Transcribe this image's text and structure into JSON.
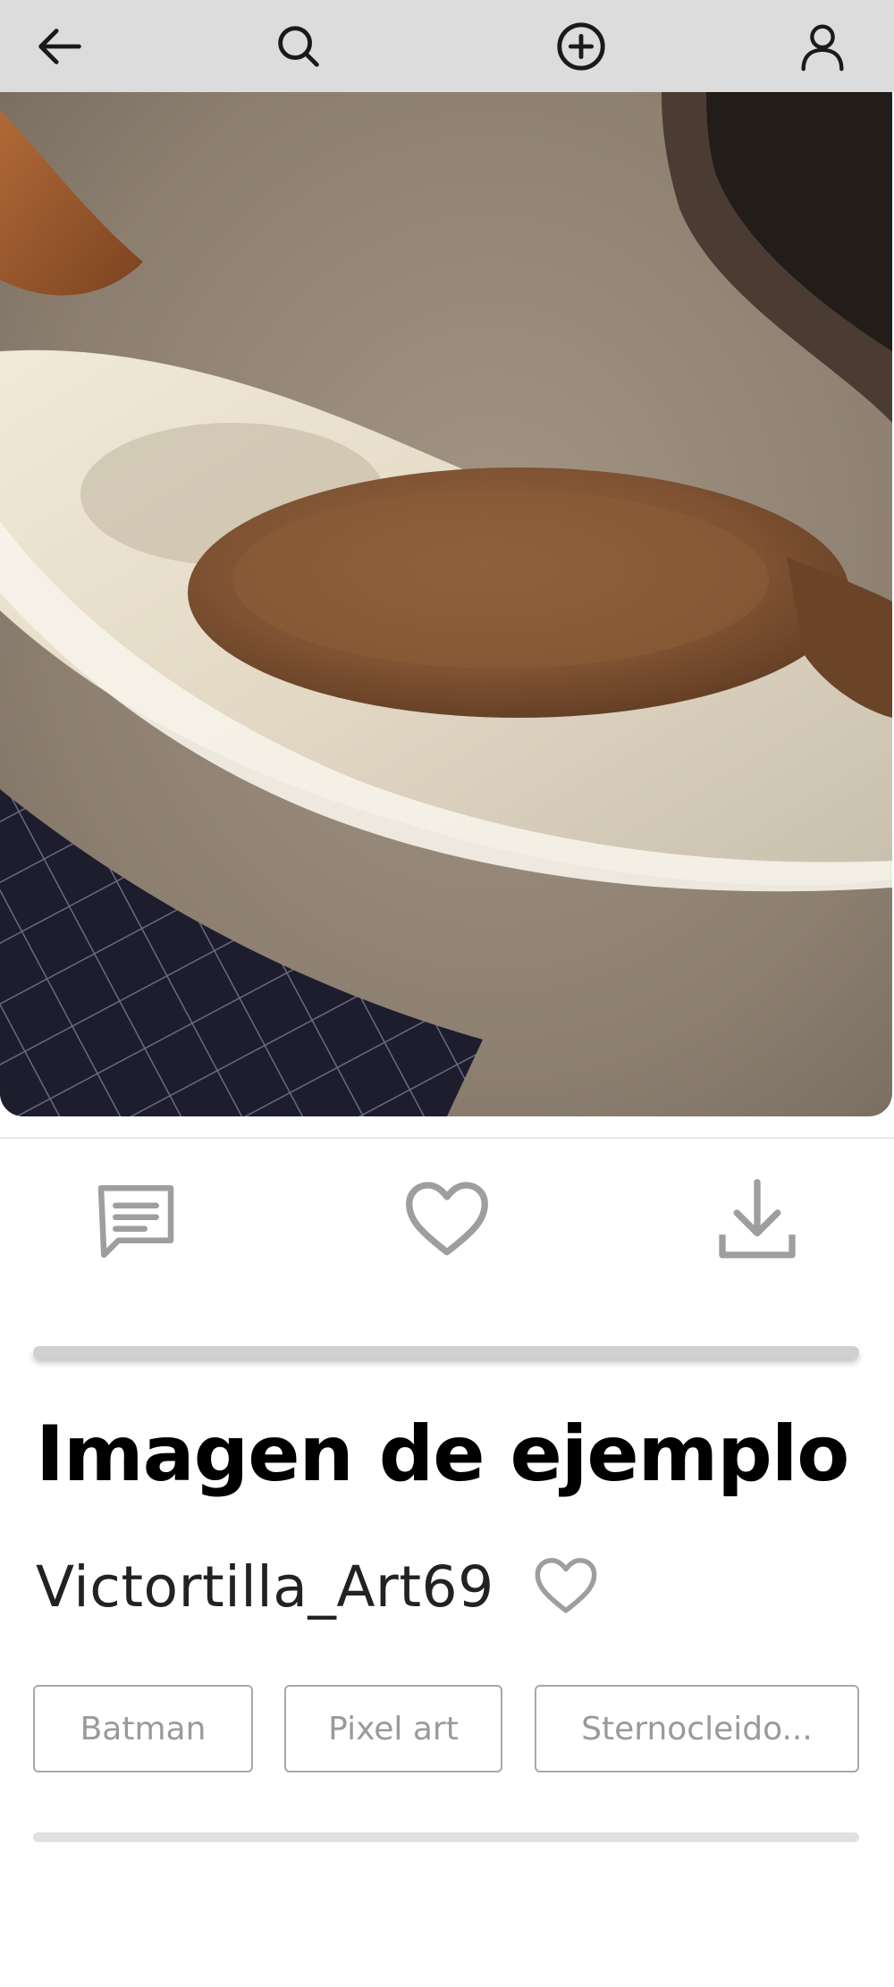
{
  "top_bar": {
    "items": [
      {
        "name": "back-icon",
        "label": "Back"
      },
      {
        "name": "search-icon",
        "label": "Search"
      },
      {
        "name": "add-circle-icon",
        "label": "Add"
      },
      {
        "name": "profile-icon",
        "label": "Profile"
      }
    ],
    "background": "#dcdcdc"
  },
  "image": {
    "subject": "wooden spoon on white ceramic spoon rest"
  },
  "actions": [
    {
      "name": "comment-icon",
      "label": "Comments"
    },
    {
      "name": "heart-icon",
      "label": "Like"
    },
    {
      "name": "download-icon",
      "label": "Download"
    }
  ],
  "post": {
    "title": "Imagen de ejemplo",
    "author": "Victortilla_Art69",
    "tags": [
      "Batman",
      "Pixel art",
      "Sternocleido..."
    ]
  },
  "colors": {
    "icon": "#9e9e9e",
    "topbar_icon": "#1a1a1a",
    "tag_border": "#a8a8a8",
    "tag_text": "#9a9a9a"
  }
}
